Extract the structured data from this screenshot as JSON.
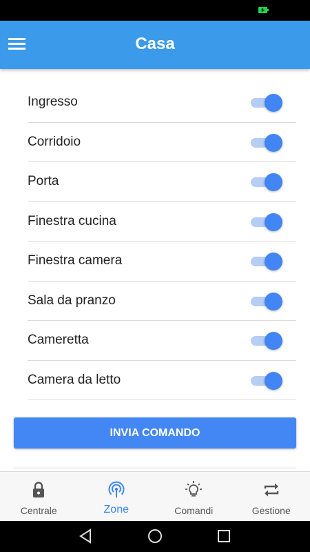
{
  "header": {
    "title": "Casa",
    "menu_icon": "hamburger-menu-icon"
  },
  "status_bar": {
    "battery_color": "#1fd34a"
  },
  "zones": [
    {
      "label": "Ingresso",
      "enabled": true
    },
    {
      "label": "Corridoio",
      "enabled": true
    },
    {
      "label": "Porta",
      "enabled": true
    },
    {
      "label": "Finestra cucina",
      "enabled": true
    },
    {
      "label": "Finestra camera",
      "enabled": true
    },
    {
      "label": "Sala da pranzo",
      "enabled": true
    },
    {
      "label": "Cameretta",
      "enabled": true
    },
    {
      "label": "Camera da letto",
      "enabled": true
    }
  ],
  "send_button": {
    "label": "INVIA COMANDO"
  },
  "bottom_nav": {
    "items": [
      {
        "label": "Centrale",
        "icon": "lock-icon",
        "active": false
      },
      {
        "label": "Zone",
        "icon": "radar-icon",
        "active": true
      },
      {
        "label": "Comandi",
        "icon": "lightbulb-icon",
        "active": false
      },
      {
        "label": "Gestione",
        "icon": "swap-arrows-icon",
        "active": false
      }
    ]
  },
  "colors": {
    "app_bar": "#3b9bea",
    "accent": "#4285f4",
    "toggle_track": "#b6cdf4",
    "active_nav": "#3b86f3",
    "inactive_nav": "#555555"
  },
  "system_nav": {
    "buttons": [
      "back-icon",
      "home-icon",
      "recents-icon"
    ]
  }
}
